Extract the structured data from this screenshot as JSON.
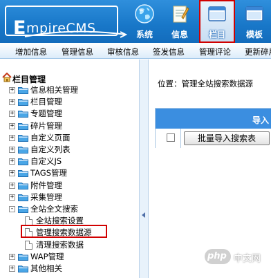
{
  "header": {
    "logo_text": "mpireCMS",
    "logo_letter": "E",
    "nav": [
      {
        "label": "系统",
        "icon": "globe-icon"
      },
      {
        "label": "信息",
        "icon": "document-icon"
      },
      {
        "label": "栏目",
        "icon": "window-icon",
        "active": true
      },
      {
        "label": "模板",
        "icon": "window-icon"
      }
    ]
  },
  "submenu": [
    "增加信息",
    "管理信息",
    "审核信息",
    "签发信息",
    "管理评论",
    "更新碎片"
  ],
  "tree": {
    "title": "栏目管理",
    "items": [
      {
        "label": "信息相关管理",
        "expanded": false
      },
      {
        "label": "栏目管理",
        "expanded": false
      },
      {
        "label": "专题管理",
        "expanded": false
      },
      {
        "label": "碎片管理",
        "expanded": false
      },
      {
        "label": "自定义页面",
        "expanded": false
      },
      {
        "label": "自定义列表",
        "expanded": false
      },
      {
        "label": "自定义JS",
        "expanded": false
      },
      {
        "label": "TAGS管理",
        "expanded": false
      },
      {
        "label": "附件管理",
        "expanded": false
      },
      {
        "label": "采集管理",
        "expanded": false
      },
      {
        "label": "全站全文搜索",
        "expanded": true
      },
      {
        "label": "WAP管理",
        "expanded": false
      },
      {
        "label": "其他相关",
        "expanded": false
      }
    ],
    "search_children": [
      "全站搜索设置",
      "管理搜索数据源",
      "清理搜索数据"
    ],
    "selected_child": "管理搜索数据源"
  },
  "main": {
    "location_label": "位置：",
    "location_link": "管理全站搜索数据源",
    "table_header": "导入",
    "batch_import_button": "批量导入搜索表"
  },
  "watermark": {
    "badge": "php",
    "site": "中文网"
  },
  "colors": {
    "header_blue": "#1877c8",
    "table_header_blue": "#3b8ee0",
    "highlight_red": "#d10000",
    "folder_blue": "#4aa6e6"
  }
}
